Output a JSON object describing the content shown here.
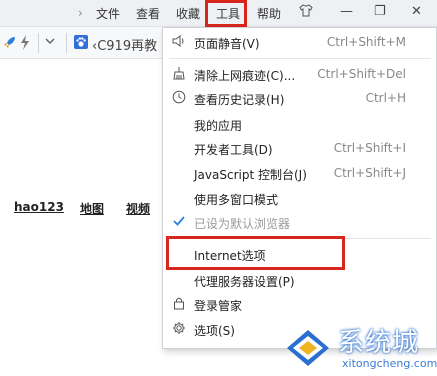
{
  "titlebar": {
    "back_arrow": "›",
    "menus": [
      "文件",
      "查看",
      "收藏",
      "工具",
      "帮助"
    ],
    "win_controls": {
      "skin": "skin-icon",
      "minimize": "—",
      "maximize": "❐",
      "close": "✕"
    }
  },
  "toolbar": {
    "site_label": "C919再教"
  },
  "content": {
    "nav_links": [
      "hao123",
      "地图",
      "视频"
    ]
  },
  "tools_menu": {
    "items": [
      {
        "icon": "speaker-icon",
        "label": "页面静音(V)",
        "shortcut": "Ctrl+Shift+M"
      },
      {
        "icon": "broom-icon",
        "label": "清除上网痕迹(C)...",
        "shortcut": "Ctrl+Shift+Del"
      },
      {
        "icon": "clock-icon",
        "label": "查看历史记录(H)",
        "shortcut": "Ctrl+H"
      },
      {
        "icon": "",
        "label": "我的应用",
        "shortcut": ""
      },
      {
        "icon": "",
        "label": "开发者工具(D)",
        "shortcut": "Ctrl+Shift+I"
      },
      {
        "icon": "",
        "label": "JavaScript 控制台(J)",
        "shortcut": "Ctrl+Shift+J"
      },
      {
        "icon": "",
        "label": "使用多窗口模式",
        "shortcut": ""
      },
      {
        "icon": "check-icon",
        "label": "已设为默认浏览器",
        "shortcut": ""
      },
      {
        "icon": "",
        "label": "Internet选项",
        "shortcut": ""
      },
      {
        "icon": "",
        "label": "代理服务器设置(P)",
        "shortcut": ""
      },
      {
        "icon": "lock-icon",
        "label": "登录管家",
        "shortcut": ""
      },
      {
        "icon": "gear-icon",
        "label": "选项(S)",
        "shortcut": ""
      }
    ]
  },
  "watermark": {
    "text": "系统城",
    "url": "xitongcheng.com"
  },
  "colors": {
    "highlight_red": "#d9261c",
    "accent_blue": "#2f7fd8"
  }
}
